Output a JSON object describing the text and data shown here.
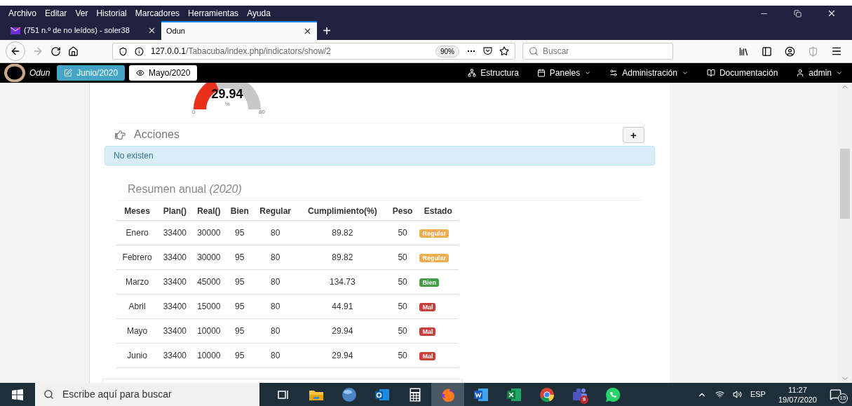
{
  "browser": {
    "menu": [
      "Archivo",
      "Editar",
      "Ver",
      "Historial",
      "Marcadores",
      "Herramientas",
      "Ayuda"
    ],
    "tabs": [
      {
        "title": "(751 n.º de no leídos) - soler38",
        "selected": false,
        "kind": "mail"
      },
      {
        "title": "Odun",
        "selected": true,
        "kind": "blank"
      }
    ],
    "new_tab": "+",
    "url": {
      "host": "127.0.0.1",
      "path": "/Tabacuba/index.php/indicators/show/2"
    },
    "zoom": "90%",
    "search": {
      "placeholder": "Buscar"
    }
  },
  "app": {
    "brand": "Odun",
    "period_buttons": [
      {
        "label": "Junio/2020",
        "kind": "edit",
        "selected": true
      },
      {
        "label": "Mayo/2020",
        "kind": "view",
        "selected": false
      }
    ],
    "nav": [
      {
        "label": "Estructura",
        "kind": "structure",
        "dropdown": false
      },
      {
        "label": "Paneles",
        "kind": "calendar",
        "dropdown": true
      },
      {
        "label": "Administración",
        "kind": "cogs",
        "dropdown": true
      },
      {
        "label": "Documentación",
        "kind": "book",
        "dropdown": false
      },
      {
        "label": "admin",
        "kind": "user",
        "dropdown": true
      }
    ]
  },
  "gauge": {
    "value": "29.94",
    "unit": "%",
    "min": "0",
    "max": "80"
  },
  "acciones": {
    "title": "Acciones",
    "add": "+",
    "alert": "No existen"
  },
  "summary": {
    "title": "Resumen anual *(2020)*",
    "columns": [
      "Meses",
      "Plan()",
      "Real()",
      "Bien",
      "Regular",
      "Cumplimiento(%)",
      "Peso",
      "Estado"
    ],
    "rows": [
      {
        "cells": [
          "Enero",
          "33400",
          "30000",
          "95",
          "80",
          "89.82",
          "50"
        ],
        "estado": {
          "label": "Regular",
          "color": "#f0ad4e"
        }
      },
      {
        "cells": [
          "Febrero",
          "33400",
          "30000",
          "95",
          "80",
          "89.82",
          "50"
        ],
        "estado": {
          "label": "Regular",
          "color": "#f0ad4e"
        }
      },
      {
        "cells": [
          "Marzo",
          "33400",
          "45000",
          "95",
          "80",
          "134.73",
          "50"
        ],
        "estado": {
          "label": "Bien",
          "color": "#449d44"
        }
      },
      {
        "cells": [
          "Abril",
          "33400",
          "15000",
          "95",
          "80",
          "44.91",
          "50"
        ],
        "estado": {
          "label": "Mal",
          "color": "#c9403a"
        }
      },
      {
        "cells": [
          "Mayo",
          "33400",
          "10000",
          "95",
          "80",
          "29.94",
          "50"
        ],
        "estado": {
          "label": "Mal",
          "color": "#c9403a"
        }
      },
      {
        "cells": [
          "Junio",
          "33400",
          "10000",
          "95",
          "80",
          "29.94",
          "50"
        ],
        "estado": {
          "label": "Mal",
          "color": "#c9403a"
        }
      }
    ]
  },
  "taskbar": {
    "search": {
      "placeholder": "Escribe aquí para buscar"
    },
    "apps": [
      {
        "kind": "task-view",
        "selected": false
      },
      {
        "kind": "folder",
        "selected": false
      },
      {
        "kind": "sphere",
        "selected": false
      },
      {
        "kind": "mail",
        "selected": false
      },
      {
        "kind": "calculator",
        "selected": false
      },
      {
        "kind": "flame",
        "selected": true
      },
      {
        "kind": "document",
        "selected": false
      },
      {
        "kind": "spreadsheet",
        "selected": false
      },
      {
        "kind": "ring",
        "selected": false
      },
      {
        "kind": "people",
        "selected": false,
        "badge": "9"
      },
      {
        "kind": "chat",
        "selected": false
      }
    ],
    "language": "ESP",
    "time": "11:27",
    "date": "19/07/2020",
    "notifications": "15"
  }
}
